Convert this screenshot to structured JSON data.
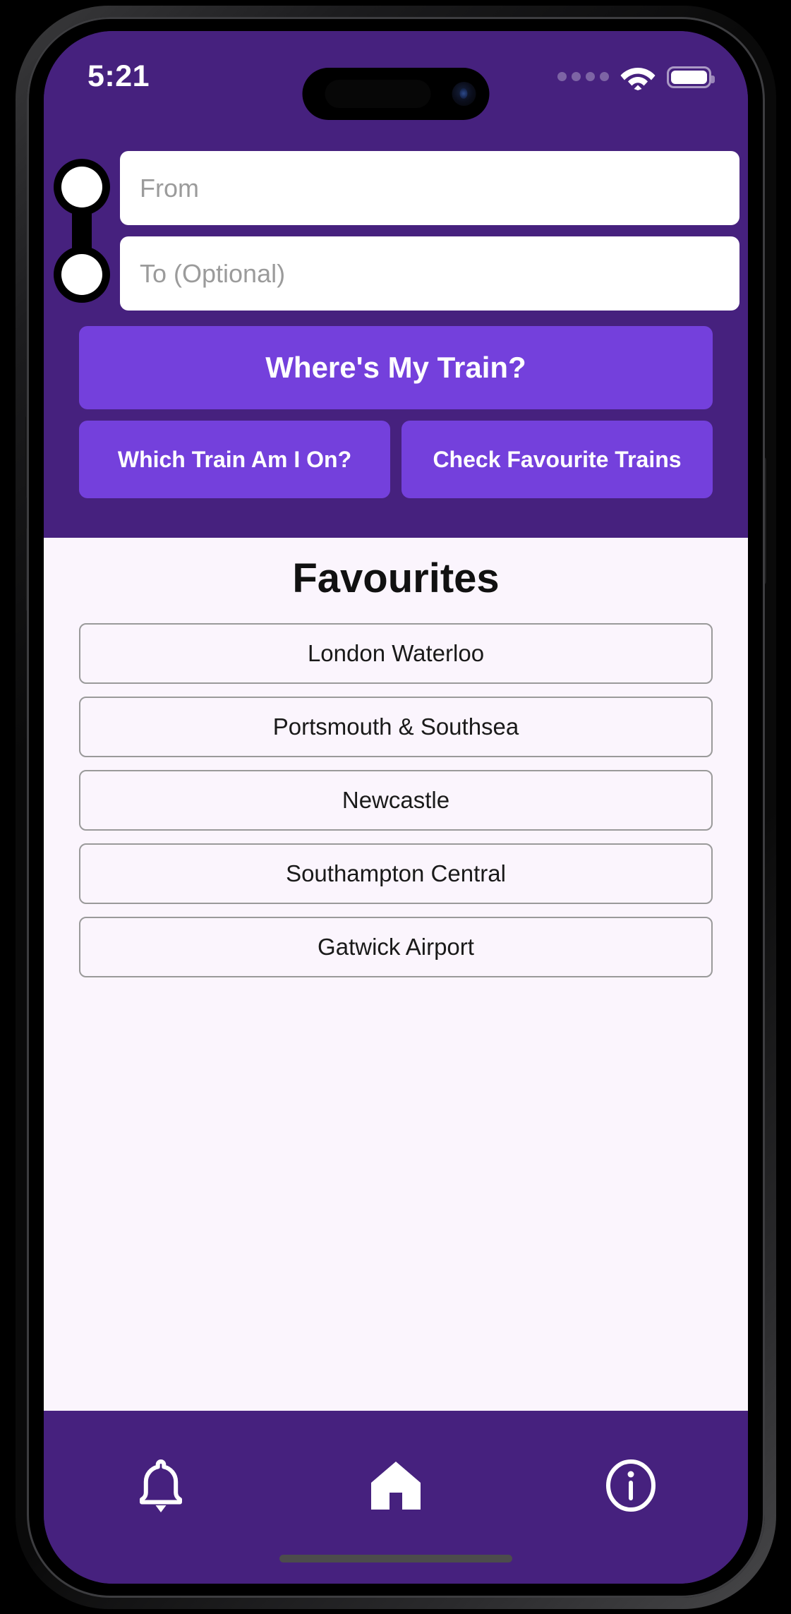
{
  "status_bar": {
    "time": "5:21",
    "signal_icon": "signal-dots-icon",
    "wifi_icon": "wifi-icon",
    "battery_icon": "battery-full-icon"
  },
  "theme": {
    "header_purple": "#46217E",
    "button_purple": "#7440DC",
    "content_background": "#FBF5FD",
    "field_background": "#FFFFFF",
    "text_on_purple": "#FFFFFF"
  },
  "search": {
    "route_indicator_icon": "route-dots-icon",
    "from_value": "",
    "from_placeholder": "From",
    "to_value": "",
    "to_placeholder": "To (Optional)"
  },
  "actions": {
    "primary_label": "Where's My Train?",
    "secondary_left_label": "Which Train Am I On?",
    "secondary_right_label": "Check Favourite Trains"
  },
  "favourites": {
    "title": "Favourites",
    "items": [
      {
        "label": "London Waterloo"
      },
      {
        "label": "Portsmouth & Southsea"
      },
      {
        "label": "Newcastle"
      },
      {
        "label": "Southampton Central"
      },
      {
        "label": "Gatwick Airport"
      }
    ]
  },
  "bottom_nav": {
    "items": [
      {
        "icon": "bell-icon",
        "name": "notifications"
      },
      {
        "icon": "home-icon",
        "name": "home"
      },
      {
        "icon": "info-circle-icon",
        "name": "info"
      }
    ]
  }
}
